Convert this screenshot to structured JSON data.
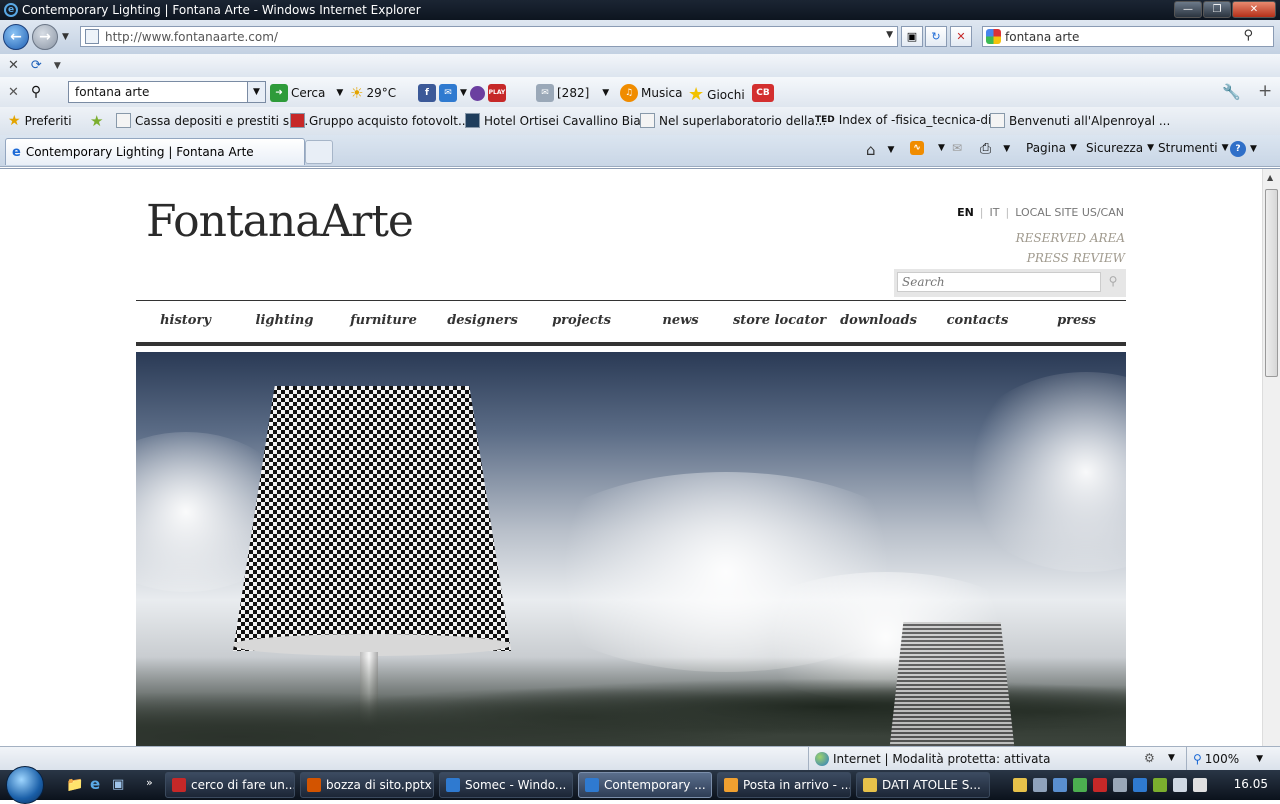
{
  "window": {
    "title": "Contemporary Lighting | Fontana Arte - Windows Internet Explorer"
  },
  "address": {
    "url": "http://www.fontanaarte.com/"
  },
  "search": {
    "value": "fontana arte"
  },
  "toolbar": {
    "search_value": "fontana arte",
    "cerca": "Cerca",
    "weather": "29°C",
    "mail_count": "[282]",
    "musica": "Musica",
    "giochi": "Giochi",
    "cb": "CB"
  },
  "favorites": {
    "label": "Preferiti",
    "items": [
      "Cassa depositi e prestiti sp...",
      "Gruppo acquisto fotovolt...",
      "Hotel Ortisei Cavallino Bia...",
      "Nel superlaboratorio della...",
      "Index of -fisica_tecnica-di...",
      "Benvenuti all'Alpenroyal ..."
    ]
  },
  "tab": {
    "title": "Contemporary Lighting | Fontana Arte"
  },
  "commandbar": {
    "pagina": "Pagina",
    "sicurezza": "Sicurezza",
    "strumenti": "Strumenti"
  },
  "site": {
    "logo": "FontanaArte",
    "lang": {
      "en": "EN",
      "it": "IT",
      "local": "LOCAL SITE US/CAN"
    },
    "reserved": "RESERVED AREA",
    "press_review": "PRESS REVIEW",
    "search_placeholder": "Search",
    "nav": [
      "history",
      "lighting",
      "furniture",
      "designers",
      "projects",
      "news",
      "store locator",
      "downloads",
      "contacts",
      "press"
    ]
  },
  "status": {
    "zone": "Internet | Modalità protetta: attivata",
    "zoom": "100%"
  },
  "taskbar": {
    "buttons": [
      "cerco di fare un...",
      "bozza di sito.pptx",
      "Somec - Windo...",
      "Contemporary ...",
      "Posta in arrivo - ...",
      "DATI ATOLLE S..."
    ],
    "clock": "16.05"
  },
  "colors": {
    "nav_text": "#333333",
    "accent_gray": "#a09a8e",
    "titlebar": "#1b2533"
  }
}
